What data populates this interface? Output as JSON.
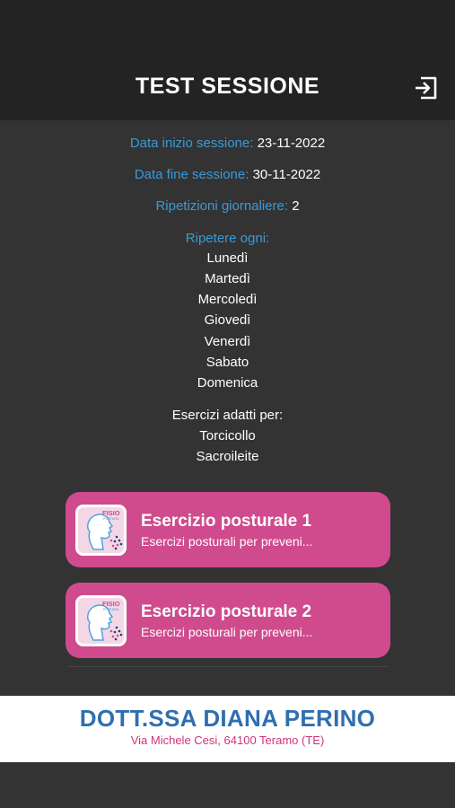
{
  "header": {
    "title": "TEST SESSIONE",
    "logout_icon": "logout-icon"
  },
  "session": {
    "start_label": "Data inizio sessione:",
    "start_value": "23-11-2022",
    "end_label": "Data fine sessione:",
    "end_value": "30-11-2022",
    "reps_label": "Ripetizioni giornaliere:",
    "reps_value": "2",
    "repeat_label": "Ripetere ogni:",
    "days": [
      "Lunedì",
      "Martedì",
      "Mercoledì",
      "Giovedì",
      "Venerdì",
      "Sabato",
      "Domenica"
    ],
    "suited_label": "Esercizi adatti per:",
    "conditions": [
      "Torcicollo",
      "Sacroileite"
    ]
  },
  "exercises": [
    {
      "title": "Esercizio posturale 1",
      "subtitle": "Esercizi posturali per preveni...",
      "thumb_text": "FISIO",
      "thumb_sub": "POSTURA"
    },
    {
      "title": "Esercizio posturale 2",
      "subtitle": "Esercizi posturali per preveni...",
      "thumb_text": "FISIO",
      "thumb_sub": "POSTURA"
    }
  ],
  "footer": {
    "name": "DOTT.SSA DIANA PERINO",
    "address": "Via Michele Cesi, 64100 Teramo (TE)"
  },
  "colors": {
    "accent_blue": "#3a9ad9",
    "card_pink": "#cf4b8d",
    "footer_blue": "#2f6fb0",
    "footer_pink": "#d0347a"
  }
}
